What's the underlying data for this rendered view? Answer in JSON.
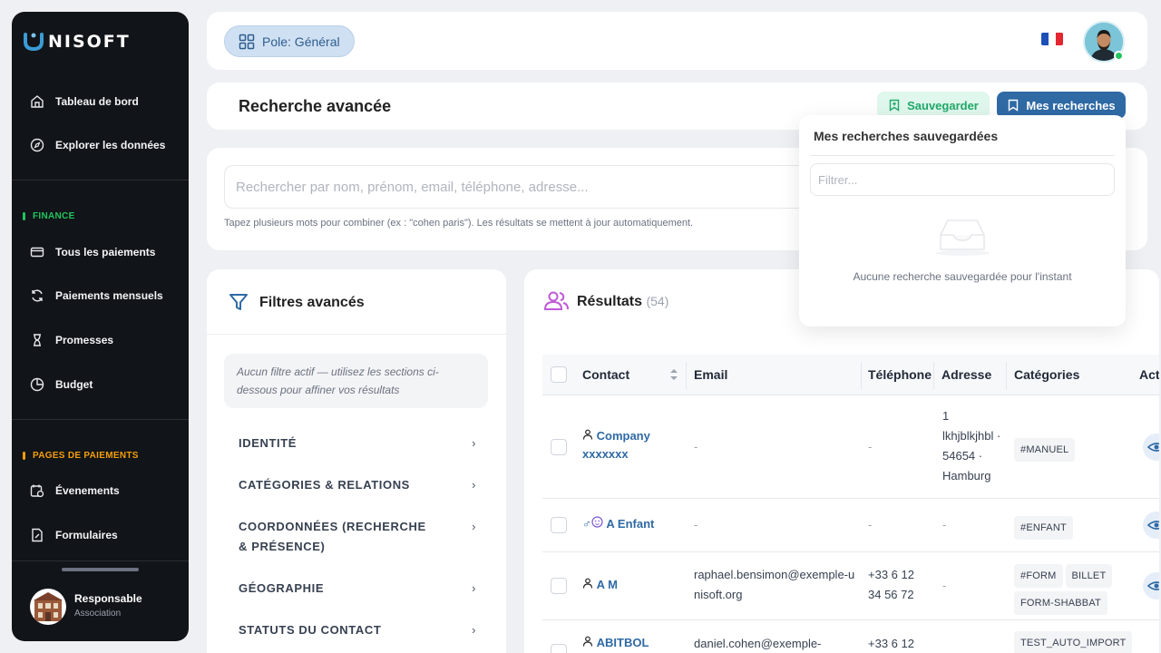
{
  "brand": {
    "name": "NISOFT",
    "accent": "#3b9bd6"
  },
  "sidebar": {
    "items_top": [
      {
        "label": "Tableau de bord",
        "icon": "home-icon"
      },
      {
        "label": "Explorer les données",
        "icon": "compass-icon"
      }
    ],
    "finance": {
      "title": "FINANCE",
      "color": "#22c55e",
      "items": [
        {
          "label": "Tous les paiements",
          "icon": "card-icon"
        },
        {
          "label": "Paiements mensuels",
          "icon": "refresh-icon"
        },
        {
          "label": "Promesses",
          "icon": "hourglass-icon"
        },
        {
          "label": "Budget",
          "icon": "pie-icon"
        }
      ]
    },
    "payment_pages": {
      "title": "PAGES DE PAIEMENTS",
      "color": "#f59e0b",
      "items": [
        {
          "label": "Évenements",
          "icon": "calendar-clock-icon"
        },
        {
          "label": "Formulaires",
          "icon": "form-icon"
        }
      ]
    },
    "profile": {
      "name": "Responsable",
      "role": "Association"
    }
  },
  "topbar": {
    "pole_label": "Pole: Général"
  },
  "header": {
    "title": "Recherche avancée",
    "save_label": "Sauvegarder",
    "my_searches_label": "Mes recherches"
  },
  "search": {
    "placeholder": "Rechercher par nom, prénom, email, téléphone, adresse...",
    "hint": "Tapez plusieurs mots pour combiner (ex : \"cohen paris\"). Les résultats se mettent à jour automatiquement."
  },
  "filters": {
    "title": "Filtres avancés",
    "note": "Aucun filtre actif — utilisez les sections ci-dessous pour affiner vos résultats",
    "sections": [
      "IDENTITÉ",
      "CATÉGORIES & RELATIONS",
      "COORDONNÉES (RECHERCHE & PRÉSENCE)",
      "GÉOGRAPHIE",
      "STATUTS DU CONTACT"
    ]
  },
  "results": {
    "title": "Résultats",
    "count": "(54)",
    "columns": [
      "Contact",
      "Email",
      "Téléphone",
      "Adresse",
      "Catégories",
      "Acti"
    ],
    "rows": [
      {
        "contact": "Company xxxxxxx",
        "email": "-",
        "phone": "-",
        "address": "1 lkhjblkjhbl · 54654 · Hamburg",
        "tags": [
          "#MANUEL"
        ]
      },
      {
        "contact": "A Enfant",
        "email": "-",
        "phone": "-",
        "address": "-",
        "tags": [
          "#ENFANT"
        ]
      },
      {
        "contact": "A M",
        "email": "raphael.bensimon@exemple-unisoft.org",
        "phone": "+33 6 12 34 56 72",
        "address": "-",
        "tags": [
          "#FORM",
          "BILLET",
          "FORM-SHABBAT"
        ]
      },
      {
        "contact": "ABITBOL",
        "email": "daniel.cohen@exemple-",
        "phone": "+33 6 12",
        "address": "",
        "tags": [
          "TEST_AUTO_IMPORT"
        ]
      }
    ]
  },
  "saved_dropdown": {
    "title": "Mes recherches sauvegardées",
    "filter_placeholder": "Filtrer...",
    "empty_text": "Aucune recherche sauvegardée pour l'instant"
  }
}
